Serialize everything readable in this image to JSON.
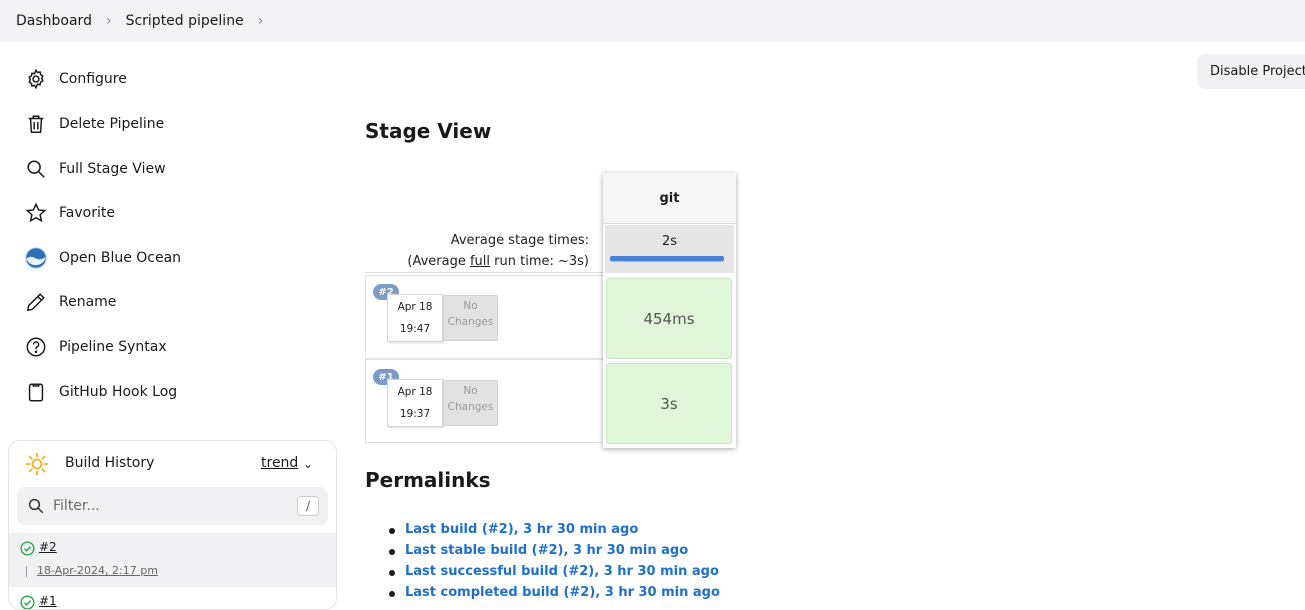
{
  "breadcrumb": {
    "items": [
      {
        "label": "Dashboard"
      },
      {
        "label": "Scripted pipeline"
      }
    ]
  },
  "sidebar": {
    "items": [
      {
        "label": "Configure",
        "icon": "gear-icon"
      },
      {
        "label": "Delete Pipeline",
        "icon": "trash-icon"
      },
      {
        "label": "Full Stage View",
        "icon": "search-icon"
      },
      {
        "label": "Favorite",
        "icon": "star-icon"
      },
      {
        "label": "Open Blue Ocean",
        "icon": "blue-ocean-icon"
      },
      {
        "label": "Rename",
        "icon": "pencil-icon"
      },
      {
        "label": "Pipeline Syntax",
        "icon": "help-icon"
      },
      {
        "label": "GitHub Hook Log",
        "icon": "clipboard-icon"
      }
    ]
  },
  "build_history": {
    "title": "Build History",
    "trend_label": "trend",
    "filter_placeholder": "Filter...",
    "filter_shortcut": "/",
    "builds": [
      {
        "number": "#2",
        "date": "18-Apr-2024, 2:17 pm",
        "status": "success"
      },
      {
        "number": "#1",
        "status": "success"
      }
    ]
  },
  "actions": {
    "disable_project": "Disable Project"
  },
  "stage_view": {
    "title": "Stage View",
    "average_label": "Average stage times:",
    "average_run_prefix": "(Average ",
    "average_run_link": "full",
    "average_run_suffix": " run time: ~3s)",
    "stage": {
      "name": "git",
      "avg_time": "2s"
    },
    "runs": [
      {
        "badge": "#2",
        "date": "Apr 18",
        "time": "19:47",
        "changes_line1": "No",
        "changes_line2": "Changes",
        "duration": "454ms"
      },
      {
        "badge": "#1",
        "date": "Apr 18",
        "time": "19:37",
        "changes_line1": "No",
        "changes_line2": "Changes",
        "duration": "3s"
      }
    ]
  },
  "permalinks": {
    "title": "Permalinks",
    "links": [
      "Last build (#2), 3 hr 30 min ago",
      "Last stable build (#2), 3 hr 30 min ago",
      "Last successful build (#2), 3 hr 30 min ago",
      "Last completed build (#2), 3 hr 30 min ago"
    ]
  },
  "colors": {
    "link": "#1d6fd2",
    "success_cell": "#dff6d9",
    "avg_bar": "#4a7fd4",
    "badge": "#7b9cc6"
  }
}
